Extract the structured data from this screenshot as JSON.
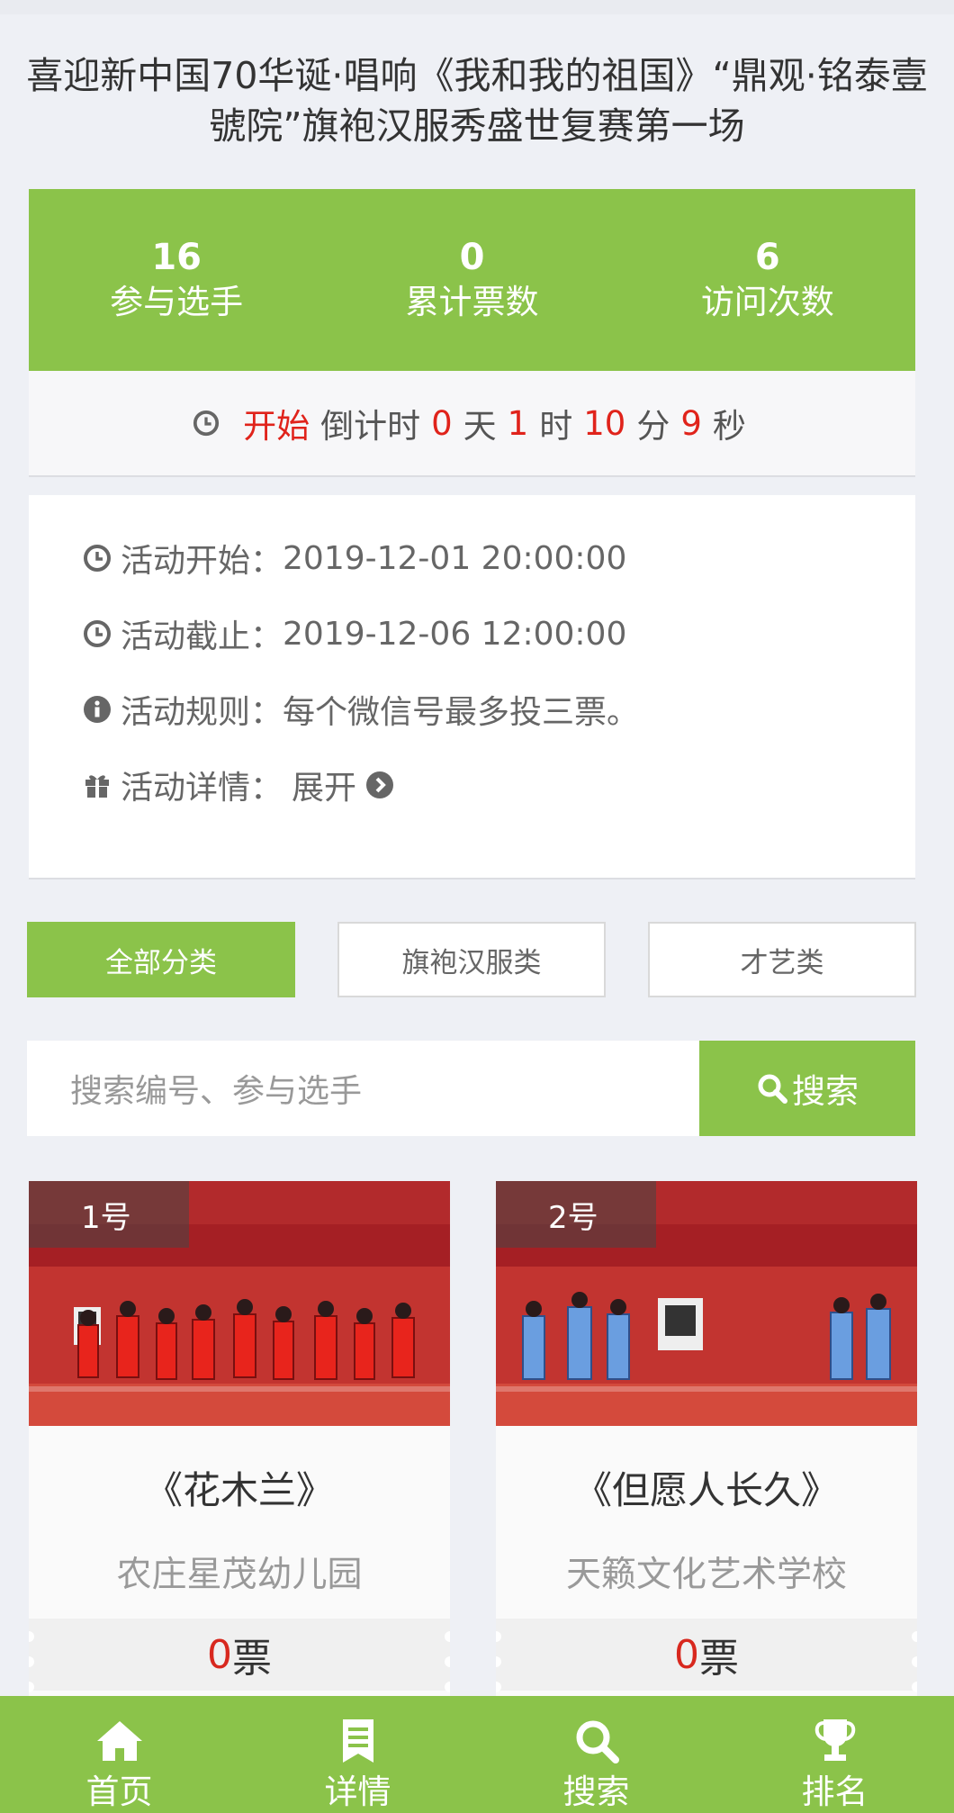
{
  "page": {
    "title": "喜迎新中国70华诞·唱响《我和我的祖国》“鼎观·铭泰壹號院”旗袍汉服秀盛世复赛第一场"
  },
  "stats": [
    {
      "value": "16",
      "label": "参与选手"
    },
    {
      "value": "0",
      "label": "累计票数"
    },
    {
      "value": "6",
      "label": "访问次数"
    }
  ],
  "countdown": {
    "status": "开始",
    "prefix": "倒计时",
    "days": "0",
    "days_unit": "天",
    "hours": "1",
    "hours_unit": "时",
    "minutes": "10",
    "minutes_unit": "分",
    "seconds": "9",
    "seconds_unit": "秒"
  },
  "info": {
    "start_label": "活动开始：",
    "start_value": "2019-12-01 20:00:00",
    "end_label": "活动截止：",
    "end_value": "2019-12-06 12:00:00",
    "rules_label": "活动规则：",
    "rules_value": "每个微信号最多投三票。",
    "details_label": "活动详情：",
    "details_expand": "展开"
  },
  "tabs": [
    {
      "label": "全部分类",
      "active": true
    },
    {
      "label": "旗袍汉服类",
      "active": false
    },
    {
      "label": "才艺类",
      "active": false
    }
  ],
  "search": {
    "placeholder": "搜索编号、参与选手",
    "button_label": "搜索"
  },
  "entries": [
    {
      "number": "1号",
      "title": "《花木兰》",
      "org": "农庄星茂幼儿园",
      "votes": "0",
      "votes_unit": "票",
      "costume_color": "#d9281f"
    },
    {
      "number": "2号",
      "title": "《但愿人长久》",
      "org": "天籁文化艺术学校",
      "votes": "0",
      "votes_unit": "票",
      "costume_color": "#6a9ee0"
    }
  ],
  "nav": [
    {
      "label": "首页",
      "icon": "home-icon"
    },
    {
      "label": "详情",
      "icon": "bookmark-icon"
    },
    {
      "label": "搜索",
      "icon": "search-icon"
    },
    {
      "label": "排名",
      "icon": "trophy-icon"
    }
  ],
  "colors": {
    "accent": "#8bc34a",
    "highlight_red": "#e0231b",
    "background": "#eef0f5"
  }
}
